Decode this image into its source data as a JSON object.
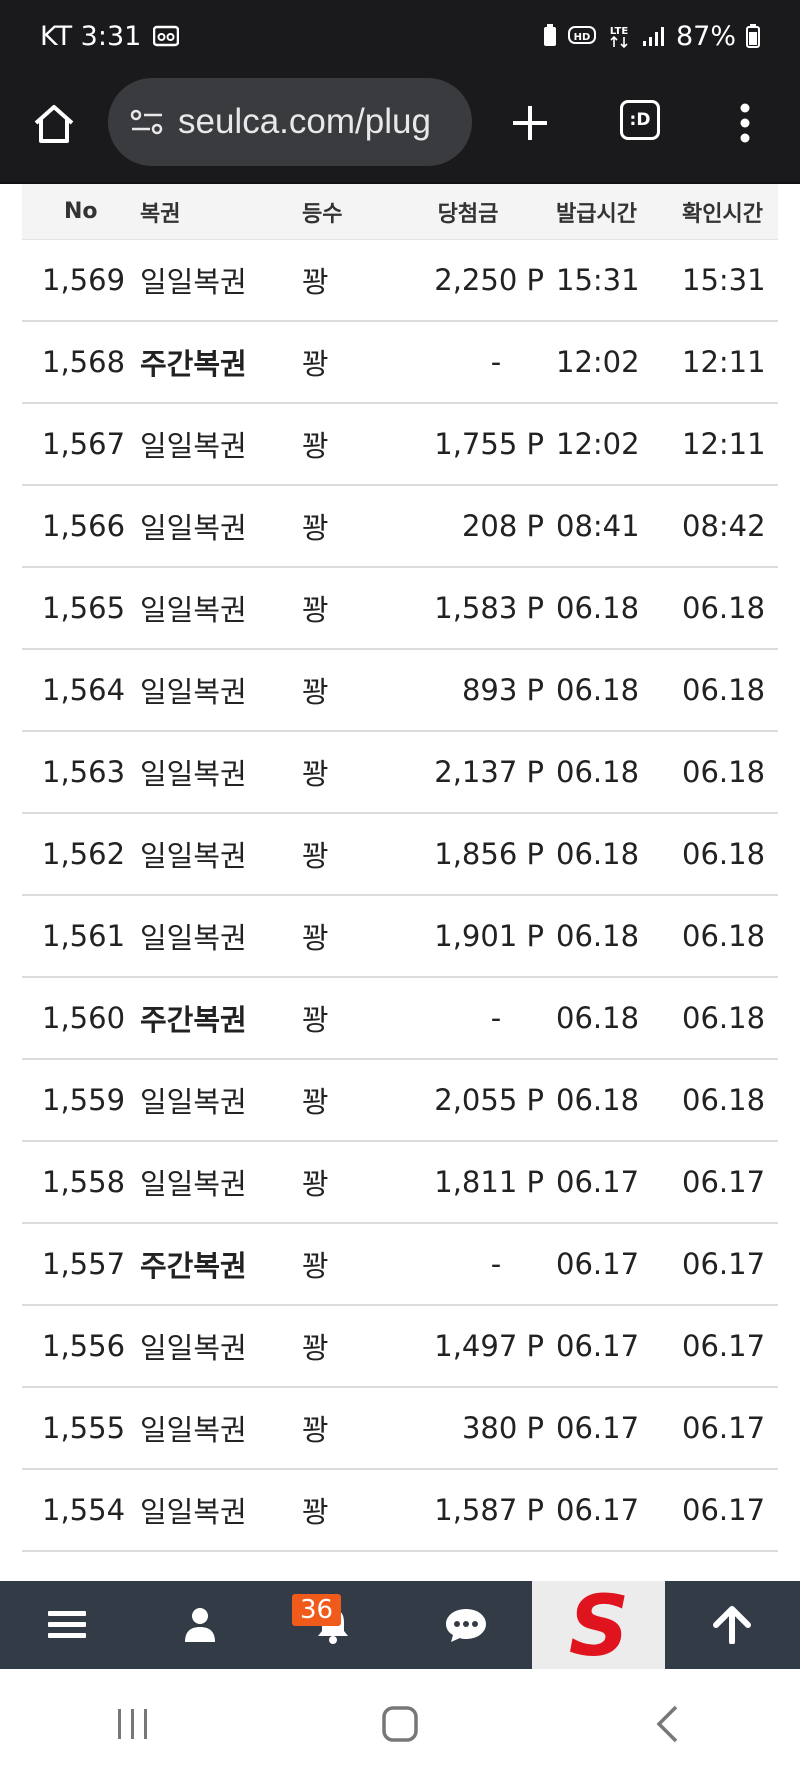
{
  "status_bar": {
    "carrier_time": "KT 3:31",
    "battery": "87%"
  },
  "browser": {
    "url": "seulca.com/plug",
    "tab_label": ":D"
  },
  "table": {
    "headers": [
      "No",
      "복권",
      "등수",
      "당첨금",
      "발급시간",
      "확인시간"
    ],
    "rows": [
      {
        "no": "1,569",
        "type": "일일복권",
        "grade": "꽝",
        "prize": "2,250 P",
        "issued": "15:31",
        "checked": "15:31",
        "bold": false
      },
      {
        "no": "1,568",
        "type": "주간복권",
        "grade": "꽝",
        "prize": "-",
        "issued": "12:02",
        "checked": "12:11",
        "bold": true
      },
      {
        "no": "1,567",
        "type": "일일복권",
        "grade": "꽝",
        "prize": "1,755 P",
        "issued": "12:02",
        "checked": "12:11",
        "bold": false
      },
      {
        "no": "1,566",
        "type": "일일복권",
        "grade": "꽝",
        "prize": "208 P",
        "issued": "08:41",
        "checked": "08:42",
        "bold": false
      },
      {
        "no": "1,565",
        "type": "일일복권",
        "grade": "꽝",
        "prize": "1,583 P",
        "issued": "06.18",
        "checked": "06.18",
        "bold": false
      },
      {
        "no": "1,564",
        "type": "일일복권",
        "grade": "꽝",
        "prize": "893 P",
        "issued": "06.18",
        "checked": "06.18",
        "bold": false
      },
      {
        "no": "1,563",
        "type": "일일복권",
        "grade": "꽝",
        "prize": "2,137 P",
        "issued": "06.18",
        "checked": "06.18",
        "bold": false
      },
      {
        "no": "1,562",
        "type": "일일복권",
        "grade": "꽝",
        "prize": "1,856 P",
        "issued": "06.18",
        "checked": "06.18",
        "bold": false
      },
      {
        "no": "1,561",
        "type": "일일복권",
        "grade": "꽝",
        "prize": "1,901 P",
        "issued": "06.18",
        "checked": "06.18",
        "bold": false
      },
      {
        "no": "1,560",
        "type": "주간복권",
        "grade": "꽝",
        "prize": "-",
        "issued": "06.18",
        "checked": "06.18",
        "bold": true
      },
      {
        "no": "1,559",
        "type": "일일복권",
        "grade": "꽝",
        "prize": "2,055 P",
        "issued": "06.18",
        "checked": "06.18",
        "bold": false
      },
      {
        "no": "1,558",
        "type": "일일복권",
        "grade": "꽝",
        "prize": "1,811 P",
        "issued": "06.17",
        "checked": "06.17",
        "bold": false
      },
      {
        "no": "1,557",
        "type": "주간복권",
        "grade": "꽝",
        "prize": "-",
        "issued": "06.17",
        "checked": "06.17",
        "bold": true
      },
      {
        "no": "1,556",
        "type": "일일복권",
        "grade": "꽝",
        "prize": "1,497 P",
        "issued": "06.17",
        "checked": "06.17",
        "bold": false
      },
      {
        "no": "1,555",
        "type": "일일복권",
        "grade": "꽝",
        "prize": "380 P",
        "issued": "06.17",
        "checked": "06.17",
        "bold": false
      },
      {
        "no": "1,554",
        "type": "일일복권",
        "grade": "꽝",
        "prize": "1,587 P",
        "issued": "06.17",
        "checked": "06.17",
        "bold": false
      }
    ]
  },
  "bottom_nav": {
    "notification_count": "36",
    "logo_letter": "S"
  },
  "colors": {
    "status_bg": "#1a1a1c",
    "url_pill": "#3a3b3f",
    "nav_bg": "#333b46",
    "badge": "#f05a1a",
    "logo_red": "#e0141e"
  }
}
